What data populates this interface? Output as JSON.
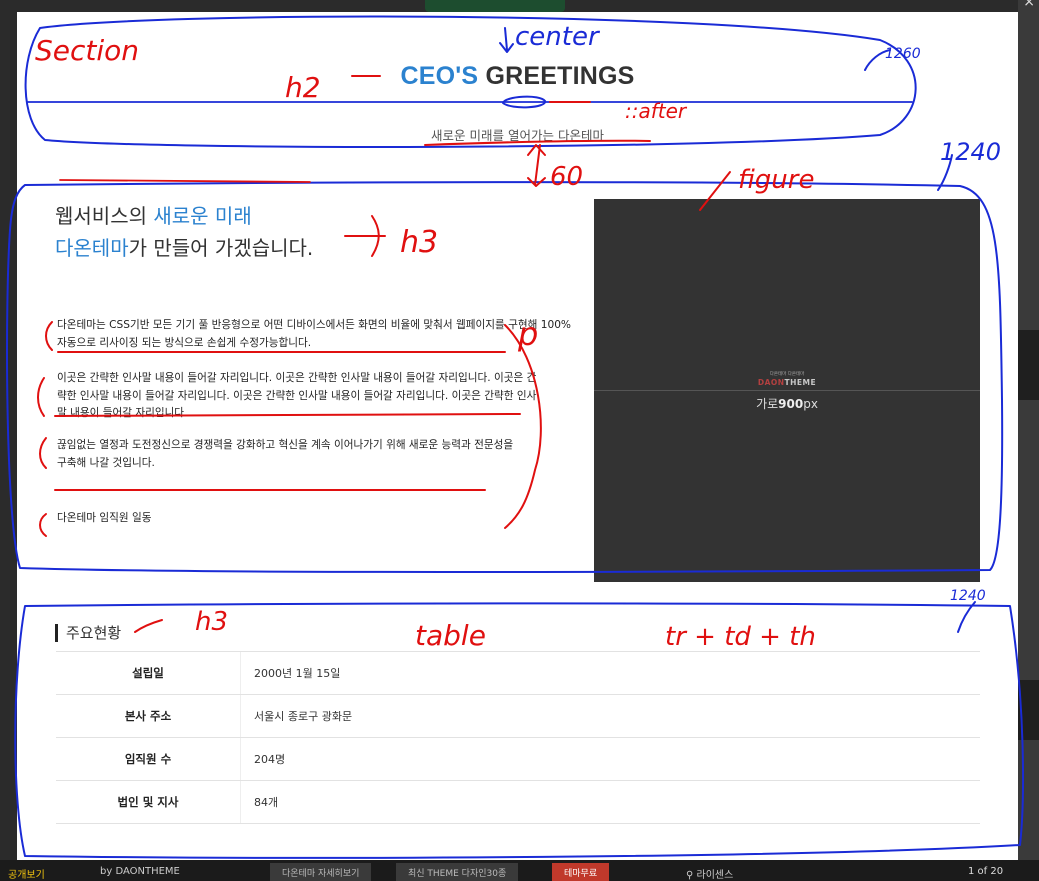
{
  "page": {
    "h2": {
      "accent": "CEO'S",
      "rest": "GREETINGS"
    },
    "subtitle": "새로운 미래를 열어가는 다온테마",
    "h3": {
      "line1_a": "웹서비스의 ",
      "line1_b": "새로운 미래",
      "line2_a": "다온테마",
      "line2_b": "가 만들어 가겠습니다."
    },
    "paragraphs": [
      "다온테마는 CSS기반 모든 기기 풀 반응형으로 어떤 디바이스에서든 화면의 비율에 맞춰서 웹페이지를 구현해 100% 자동으로 리사이징 되는 방식으로 손쉽게 수정가능합니다.",
      "이곳은 간략한 인사말 내용이 들어갈 자리입니다. 이곳은 간략한 인사말 내용이 들어갈 자리입니다. 이곳은 간략한 인사말 내용이 들어갈 자리입니다. 이곳은 간략한 인사말 내용이 들어갈 자리입니다. 이곳은 간략한 인사말 내용이 들어갈 자리입니다.",
      "끊임없는 열정과 도전정신으로 경쟁력을 강화하고 혁신을 계속 이어나가기 위해 새로운 능력과 전문성을 구축해 나갈 것입니다.",
      "다온테마 임직원 일동"
    ],
    "figure": {
      "logo_small": "다온테마 다온테마",
      "logo_a": "DAON",
      "logo_b": "THEME",
      "caption_a": "가로",
      "caption_b": "900",
      "caption_c": "px"
    },
    "status_title": "주요현황",
    "table": [
      {
        "th": "설립일",
        "td": "2000년 1월 15일"
      },
      {
        "th": "본사 주소",
        "td": "서울시 종로구 광화문"
      },
      {
        "th": "임직원 수",
        "td": "204명"
      },
      {
        "th": "법인 및 지사",
        "td": "84개"
      }
    ]
  },
  "annotations": {
    "section": "Section",
    "center": "center",
    "width_top": "1260",
    "h2": "h2",
    "after": "::after",
    "gap": "60",
    "width_mid": "1240",
    "figure": "figure",
    "h3": "h3",
    "p": "p",
    "width_bottom": "1240",
    "h3_table": "h3",
    "table": "table",
    "tr": "tr + td + th"
  },
  "bottom_bar": {
    "left": "공개보기",
    "author": "by DAONTHEME",
    "btn1": "다온테마 자세히보기",
    "btn2": "최신 THEME 다자인30종",
    "btn3": "테마무료",
    "license": "라이센스",
    "pager": "1 of 20"
  },
  "colors": {
    "accent": "#2b82cf",
    "annot_blue": "#1a2bd6",
    "annot_red": "#e01010"
  }
}
